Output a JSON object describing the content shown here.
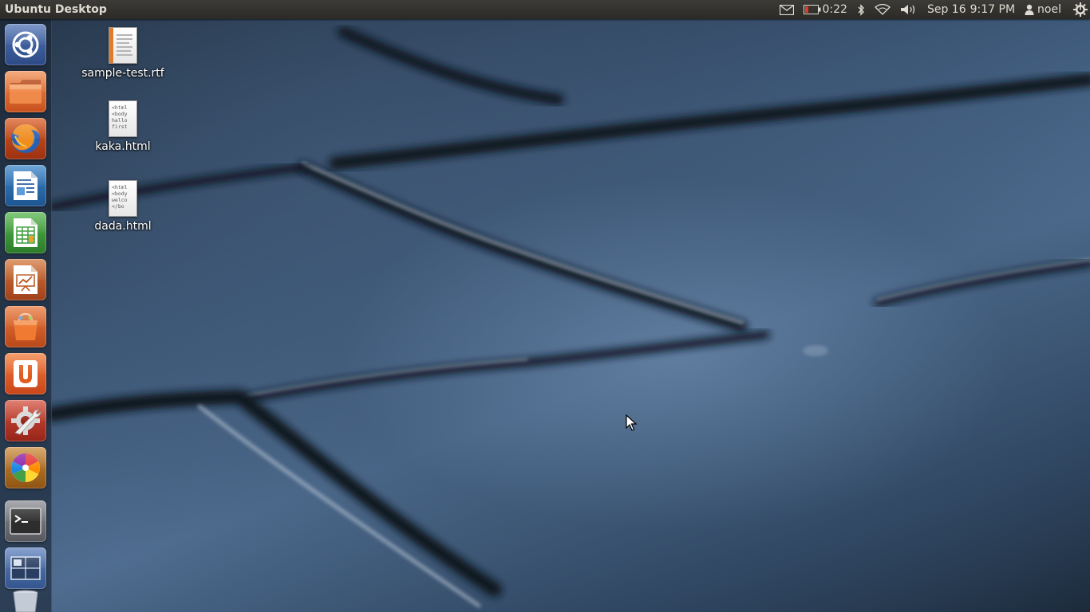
{
  "panel": {
    "title": "Ubuntu Desktop",
    "battery_time": "0:22",
    "date": "Sep 16",
    "time": "9:17 PM",
    "user": "noel"
  },
  "launcher": {
    "items": [
      {
        "name": "dash-home",
        "icon": "ubuntu-logo-icon",
        "color": "#3d5f9e"
      },
      {
        "name": "files",
        "icon": "folder-icon",
        "color": "#e2672a"
      },
      {
        "name": "firefox",
        "icon": "firefox-icon",
        "color": "#c2461b"
      },
      {
        "name": "libreoffice-writer",
        "icon": "writer-icon",
        "color": "#2a6aa6"
      },
      {
        "name": "libreoffice-calc",
        "icon": "calc-icon",
        "color": "#3d9a3a"
      },
      {
        "name": "libreoffice-impress",
        "icon": "impress-icon",
        "color": "#b9521c"
      },
      {
        "name": "software-center",
        "icon": "shopping-bag-icon",
        "color": "#d95f1f"
      },
      {
        "name": "ubuntu-one",
        "icon": "ubuntu-one-icon",
        "color": "#e05b1c"
      },
      {
        "name": "system-settings",
        "icon": "settings-wrench-icon",
        "color": "#c0392b"
      },
      {
        "name": "shotwell",
        "icon": "color-wheel-icon",
        "color": "#b8721e"
      },
      {
        "name": "terminal",
        "icon": "terminal-icon",
        "color": "#6e7178"
      },
      {
        "name": "workspace-switcher",
        "icon": "workspaces-icon",
        "color": "#4a6ea8"
      }
    ],
    "trash_icon": "trash-icon"
  },
  "desktop_icons": [
    {
      "label": "sample-test.rtf",
      "type": "rtf"
    },
    {
      "label": "kaka.html",
      "type": "html",
      "preview": "<html\n<body\nhallo\nfirst"
    },
    {
      "label": "dada.html",
      "type": "html",
      "preview": "<html\n<body\nwelco\n</bo"
    }
  ]
}
